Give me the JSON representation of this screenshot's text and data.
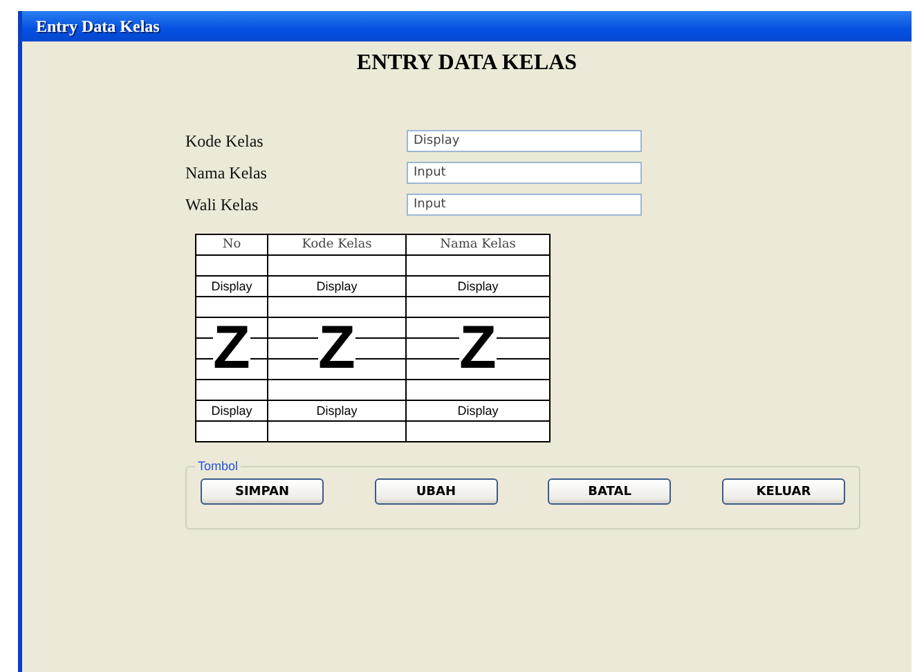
{
  "window": {
    "title": "Entry Data Kelas"
  },
  "heading": "ENTRY DATA KELAS",
  "fields": [
    {
      "label": "Kode Kelas",
      "value": "Display"
    },
    {
      "label": "Nama Kelas",
      "value": "Input"
    },
    {
      "label": "Wali Kelas",
      "value": "Input"
    }
  ],
  "table": {
    "columns": [
      "No",
      "Kode Kelas",
      "Nama Kelas"
    ],
    "rows": [
      {
        "kind": "row",
        "cells": [
          "",
          "",
          ""
        ]
      },
      {
        "kind": "row",
        "cells": [
          "Display",
          "Display",
          "Display"
        ]
      },
      {
        "kind": "row",
        "cells": [
          "",
          "",
          ""
        ]
      },
      {
        "kind": "gap",
        "cells": [
          "Z",
          "Z",
          "Z"
        ]
      },
      {
        "kind": "row",
        "cells": [
          "",
          "",
          ""
        ]
      },
      {
        "kind": "row",
        "cells": [
          "Display",
          "Display",
          "Display"
        ]
      },
      {
        "kind": "row",
        "cells": [
          "",
          "",
          ""
        ]
      }
    ]
  },
  "button_group": {
    "title": "Tombol",
    "buttons": [
      "SIMPAN",
      "UBAH",
      "BATAL",
      "KELUAR"
    ]
  }
}
